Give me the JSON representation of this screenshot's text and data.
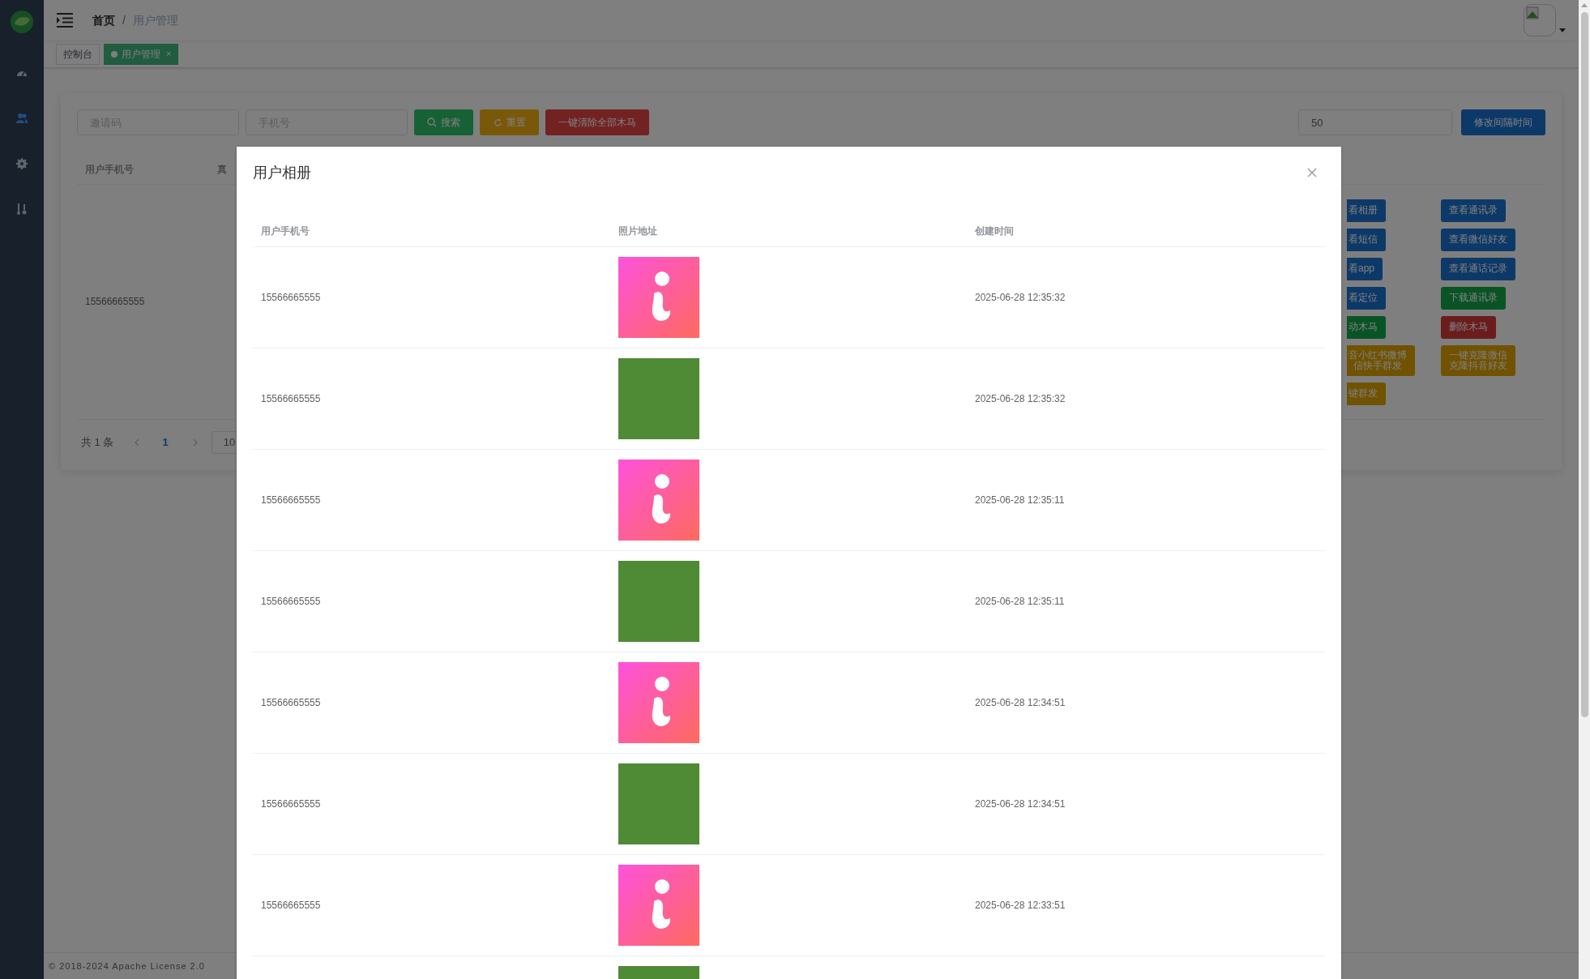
{
  "sidebar": {
    "items": [
      {
        "kind": "dashboard",
        "selected": false
      },
      {
        "kind": "users",
        "selected": true
      },
      {
        "kind": "settings",
        "selected": false
      },
      {
        "kind": "tools",
        "selected": false
      }
    ]
  },
  "header": {
    "breadcrumb": [
      "首页",
      "/",
      "用户管理"
    ]
  },
  "tabs": [
    {
      "label": "控制台",
      "selected": false
    },
    {
      "label": "用户管理",
      "selected": true,
      "close": "×"
    }
  ],
  "filters": {
    "fields": [
      {
        "placeholder": "邀请码"
      },
      {
        "placeholder": "手机号"
      }
    ],
    "buttons": [
      {
        "label": "搜索",
        "kind": "search"
      },
      {
        "label": "重置",
        "kind": "reset"
      },
      {
        "label": "一键清除全部木马",
        "kind": "danger"
      }
    ],
    "interval": {
      "value": "50",
      "button": "修改间隔时间"
    }
  },
  "table": {
    "columns": [
      "用户手机号",
      "真"
    ],
    "rows": [
      {
        "phone": "15566665555"
      }
    ],
    "actions": [
      [
        {
          "lines": [
            "看相册"
          ],
          "kind": "primary"
        },
        {
          "lines": [
            "看短信"
          ],
          "kind": "primary"
        },
        {
          "lines": [
            "看app"
          ],
          "kind": "primary"
        },
        {
          "lines": [
            "看定位"
          ],
          "kind": "primary"
        },
        {
          "lines": [
            "动木马"
          ],
          "kind": "success"
        },
        {
          "lines": [
            "音小红书微博",
            "信快手群发"
          ],
          "kind": "warning"
        },
        {
          "lines": [
            "键群发"
          ],
          "kind": "warning"
        }
      ],
      [
        {
          "lines": [
            "查看通讯录"
          ],
          "kind": "primary"
        },
        {
          "lines": [
            "查看微信好友"
          ],
          "kind": "primary"
        },
        {
          "lines": [
            "查看通话记录"
          ],
          "kind": "primary"
        },
        {
          "lines": [
            "下载通讯录"
          ],
          "kind": "success"
        },
        {
          "lines": [
            "删除木马"
          ],
          "kind": "danger"
        },
        {
          "lines": [
            "一键克隆微信",
            "克隆抖音好友"
          ],
          "kind": "warning"
        }
      ]
    ]
  },
  "pagination": {
    "total": "共 1 条",
    "page": "1",
    "page_size": "10"
  },
  "footer": "© 2018-2024 Apache License 2.0",
  "dialog": {
    "title": "用户相册",
    "columns": [
      "用户手机号",
      "照片地址",
      "创建时间"
    ],
    "rows": [
      {
        "phone": "15566665555",
        "kind": "icon",
        "created": "2025-06-28 12:35:32"
      },
      {
        "phone": "15566665555",
        "kind": "photo",
        "created": "2025-06-28 12:35:32"
      },
      {
        "phone": "15566665555",
        "kind": "icon",
        "created": "2025-06-28 12:35:11"
      },
      {
        "phone": "15566665555",
        "kind": "photo",
        "created": "2025-06-28 12:35:11"
      },
      {
        "phone": "15566665555",
        "kind": "icon",
        "created": "2025-06-28 12:34:51"
      },
      {
        "phone": "15566665555",
        "kind": "photo",
        "created": "2025-06-28 12:34:51"
      },
      {
        "phone": "15566665555",
        "kind": "icon",
        "created": "2025-06-28 12:33:51"
      },
      {
        "kind": "photo"
      }
    ]
  }
}
